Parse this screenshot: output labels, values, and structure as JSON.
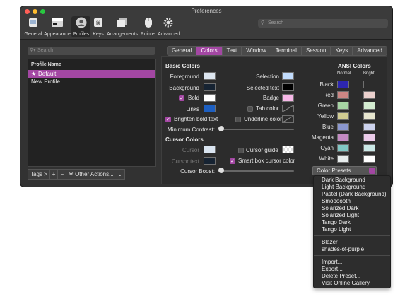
{
  "window": {
    "title": "Preferences"
  },
  "toolbar": {
    "items": [
      {
        "label": "General",
        "icon": "general-icon"
      },
      {
        "label": "Appearance",
        "icon": "appearance-icon"
      },
      {
        "label": "Profiles",
        "icon": "profiles-icon",
        "selected": true
      },
      {
        "label": "Keys",
        "icon": "keys-icon"
      },
      {
        "label": "Arrangements",
        "icon": "arrangements-icon"
      },
      {
        "label": "Pointer",
        "icon": "pointer-icon"
      },
      {
        "label": "Advanced",
        "icon": "advanced-icon"
      }
    ],
    "search_placeholder": "Search"
  },
  "profiles": {
    "search_placeholder": "Search",
    "header": "Profile Name",
    "items": [
      "Default",
      "New Profile"
    ],
    "tags_label": "Tags >",
    "add_label": "+",
    "remove_label": "−",
    "other_actions_label": "Other Actions..."
  },
  "tabs": [
    "General",
    "Colors",
    "Text",
    "Window",
    "Terminal",
    "Session",
    "Keys",
    "Advanced"
  ],
  "basic_colors": {
    "header": "Basic Colors",
    "foreground": "Foreground",
    "background": "Background",
    "bold": "Bold",
    "links": "Links",
    "selection": "Selection",
    "selected_text": "Selected text",
    "badge": "Badge",
    "tab_color": "Tab color",
    "underline_color": "Underline color",
    "brighten_bold": "Brighten bold text",
    "min_contrast": "Minimum Contrast:",
    "colors": {
      "foreground": "#dde6f0",
      "background": "#162332",
      "bold": "#ffffff",
      "links": "#1d5fc1",
      "selection": "#c2dcfd",
      "selected_text": "#000000",
      "badge": "#f7b8e8"
    }
  },
  "cursor_colors": {
    "header": "Cursor Colors",
    "cursor": "Cursor",
    "cursor_text": "Cursor text",
    "cursor_guide": "Cursor guide",
    "smart_box": "Smart box cursor color",
    "cursor_boost": "Cursor Boost:",
    "colors": {
      "cursor": "#d9e4f0",
      "cursor_text": "#162332"
    }
  },
  "ansi": {
    "header": "ANSI Colors",
    "normal_label": "Normal",
    "bright_label": "Bright",
    "rows": [
      {
        "name": "Black",
        "normal": "#2d26b0",
        "bright": "#2c2c2c"
      },
      {
        "name": "Red",
        "normal": "#cb8684",
        "bright": "#ead0cd"
      },
      {
        "name": "Green",
        "normal": "#a7d4a4",
        "bright": "#d4ecd1"
      },
      {
        "name": "Yellow",
        "normal": "#d0cb92",
        "bright": "#e7e6cf"
      },
      {
        "name": "Blue",
        "normal": "#8b97cf",
        "bright": "#cdd3ee"
      },
      {
        "name": "Magenta",
        "normal": "#c38ac1",
        "bright": "#ecccea"
      },
      {
        "name": "Cyan",
        "normal": "#81c7c4",
        "bright": "#cbe9e7"
      },
      {
        "name": "White",
        "normal": "#e7ecec",
        "bright": "#ffffff"
      }
    ]
  },
  "presets": {
    "button_label": "Color Presets...",
    "group1": [
      "Dark Background",
      "Light Background",
      "Pastel (Dark Background)",
      "Smoooooth",
      "Solarized Dark",
      "Solarized Light",
      "Tango Dark",
      "Tango Light"
    ],
    "group2": [
      "Blazer",
      "shades-of-purple"
    ],
    "group3": [
      "Import...",
      "Export...",
      "Delete Preset...",
      "Visit Online Gallery"
    ]
  },
  "accent": "#a347a3"
}
